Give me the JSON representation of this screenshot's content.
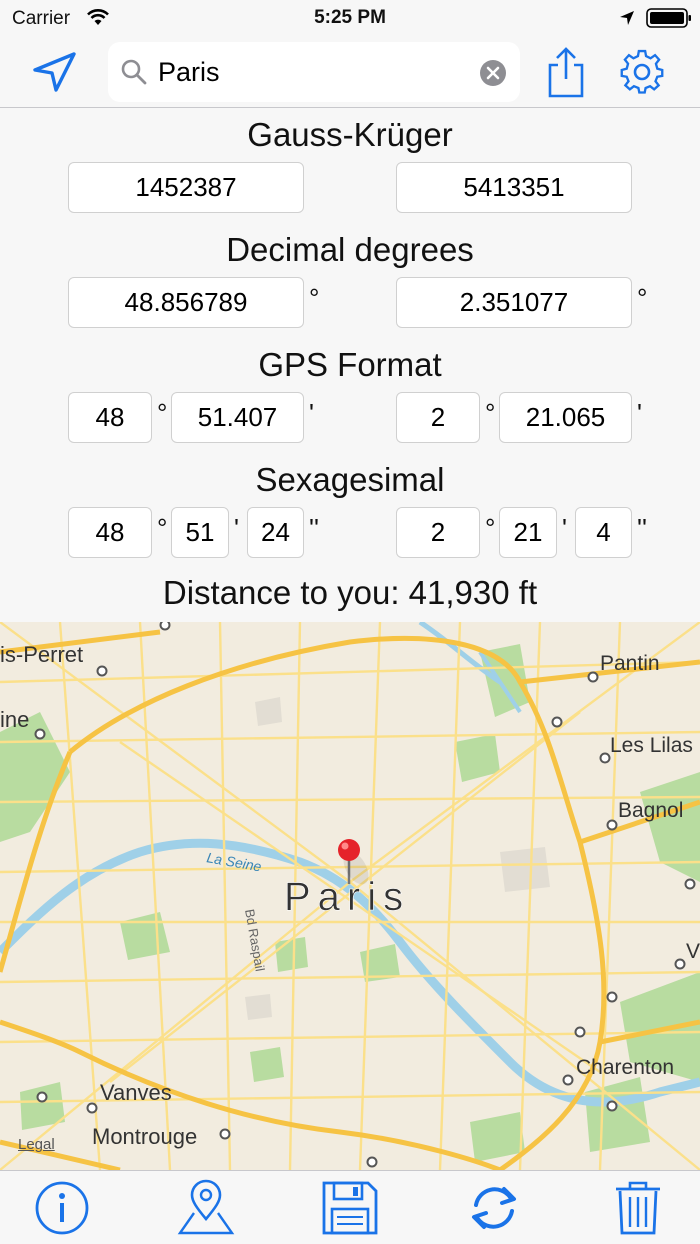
{
  "status_bar": {
    "carrier": "Carrier",
    "time": "5:25 PM"
  },
  "search": {
    "value": "Paris",
    "placeholder": ""
  },
  "icons": {
    "locate": "location-arrow-icon",
    "search": "magnifier-icon",
    "clear": "clear-circle-icon",
    "share": "share-icon",
    "settings": "gear-icon",
    "info": "info-icon",
    "pin": "map-pin-icon",
    "save": "floppy-disk-icon",
    "refresh": "refresh-icon",
    "trash": "trash-icon"
  },
  "colors": {
    "accent": "#1a73e8",
    "map_bg": "#f2ecdf",
    "road_major": "#f6c344",
    "road_minor": "#fbe08a",
    "water": "#9fd0e8",
    "park": "#b8dca0"
  },
  "gauss_kruger": {
    "title": "Gauss-Krüger",
    "x": "1452387",
    "y": "5413351"
  },
  "decimal_degrees": {
    "title": "Decimal degrees",
    "lat": "48.856789",
    "lon": "2.351077",
    "unit": "°"
  },
  "gps_format": {
    "title": "GPS Format",
    "lat_deg": "48",
    "lat_min": "51.407",
    "lon_deg": "2",
    "lon_min": "21.065",
    "deg_unit": "°",
    "min_unit": "'"
  },
  "sexagesimal": {
    "title": "Sexagesimal",
    "lat_deg": "48",
    "lat_min": "51",
    "lat_sec": "24",
    "lon_deg": "2",
    "lon_min": "21",
    "lon_sec": "4",
    "deg_unit": "°",
    "min_unit": "'",
    "sec_unit": "''"
  },
  "distance": "Distance to you: 41,930 ft",
  "map": {
    "city_label": "Paris",
    "labels": {
      "perret": "is-Perret",
      "ine": "ine",
      "pantin": "Pantin",
      "lilas": "Les Lilas",
      "bagnol": "Bagnol",
      "seine": "La Seine",
      "raspail": "Bd Raspail",
      "vanves": "Vanves",
      "montrouge": "Montrouge",
      "charenton": "Charenton",
      "v": "V"
    },
    "legal": "Legal"
  }
}
